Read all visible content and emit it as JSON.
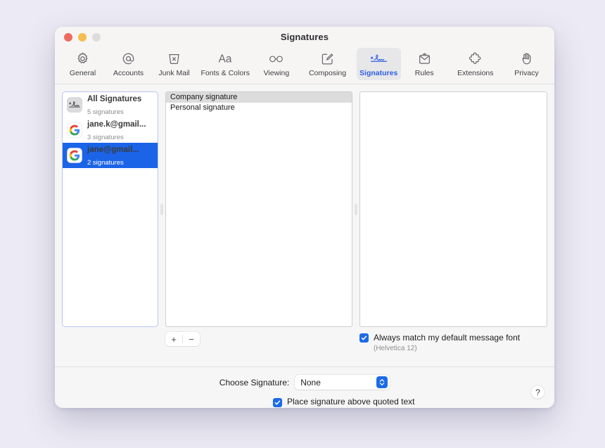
{
  "window": {
    "title": "Signatures",
    "traffic_lights": [
      "close",
      "minimize",
      "zoom"
    ]
  },
  "toolbar": {
    "items": [
      {
        "label": "General",
        "icon": "gear-icon",
        "selected": false
      },
      {
        "label": "Accounts",
        "icon": "at-sign-icon",
        "selected": false
      },
      {
        "label": "Junk Mail",
        "icon": "trash-x-icon",
        "selected": false
      },
      {
        "label": "Fonts & Colors",
        "icon": "aa-text-icon",
        "selected": false
      },
      {
        "label": "Viewing",
        "icon": "glasses-icon",
        "selected": false
      },
      {
        "label": "Composing",
        "icon": "compose-pencil-icon",
        "selected": false
      },
      {
        "label": "Signatures",
        "icon": "signature-icon",
        "selected": true
      },
      {
        "label": "Rules",
        "icon": "envelope-star-icon",
        "selected": false
      },
      {
        "label": "Extensions",
        "icon": "puzzle-piece-icon",
        "selected": false
      },
      {
        "label": "Privacy",
        "icon": "hand-icon",
        "selected": false
      }
    ]
  },
  "sidebar": {
    "accounts": [
      {
        "name": "All Signatures",
        "detail": "5 signatures",
        "icon": "signature-badge-icon",
        "selected": false,
        "bold": true
      },
      {
        "name": "jane.k@gmail...",
        "detail": "3 signatures",
        "icon": "google-icon",
        "selected": false,
        "bold": true
      },
      {
        "name": "jane@gmail...",
        "detail": "2 signatures",
        "icon": "google-icon",
        "selected": true,
        "bold": true
      }
    ]
  },
  "signature_list": {
    "rows": [
      {
        "label": "Company signature",
        "selected": true
      },
      {
        "label": "Personal signature",
        "selected": false
      }
    ]
  },
  "preview": {
    "content": ""
  },
  "list_controls": {
    "add_label": "+",
    "remove_label": "−"
  },
  "font_option": {
    "label": "Always match my default message font",
    "sublabel": "(Helvetica 12)",
    "checked": true
  },
  "footer": {
    "choose_signature_label": "Choose Signature:",
    "choose_signature_value": "None",
    "place_above_label": "Place signature above quoted text",
    "place_above_checked": true,
    "help_label": "?"
  },
  "colors": {
    "accent": "#1b6ae8",
    "selection": "#1b64e8",
    "page_background": "#eceaf4",
    "toolbar_selected_bg": "#e7e7ea"
  }
}
